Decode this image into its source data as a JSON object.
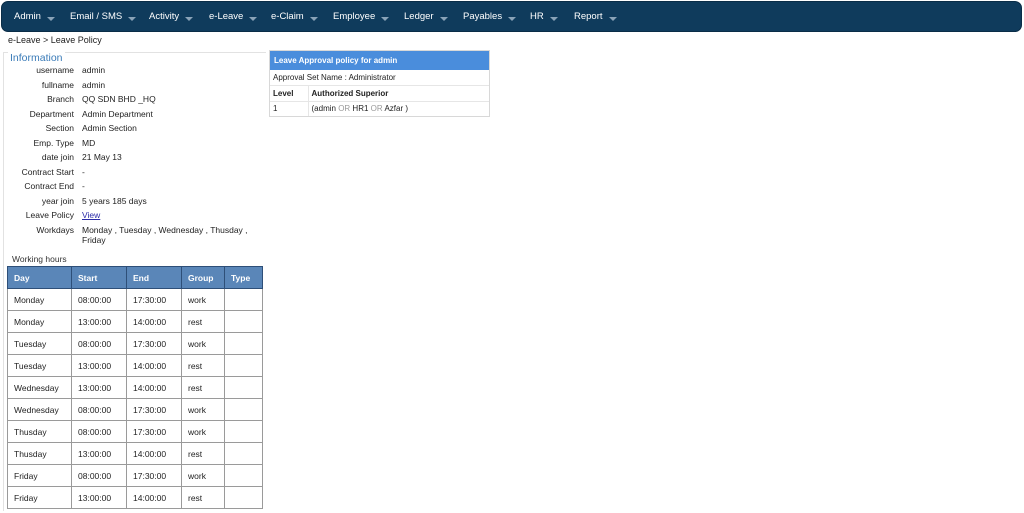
{
  "nav": {
    "items": [
      {
        "label": "Admin"
      },
      {
        "label": "Email / SMS"
      },
      {
        "label": "Activity"
      },
      {
        "label": "e-Leave"
      },
      {
        "label": "e-Claim"
      },
      {
        "label": "Employee"
      },
      {
        "label": "Ledger"
      },
      {
        "label": "Payables"
      },
      {
        "label": "HR"
      },
      {
        "label": "Report"
      }
    ]
  },
  "breadcrumb": "e-Leave > Leave Policy",
  "info": {
    "legend": "Information",
    "rows": [
      {
        "label": "username",
        "value": "admin"
      },
      {
        "label": "fullname",
        "value": "admin"
      },
      {
        "label": "Branch",
        "value": "QQ SDN BHD _HQ"
      },
      {
        "label": "Department",
        "value": "Admin Department"
      },
      {
        "label": "Section",
        "value": "Admin Section"
      },
      {
        "label": "Emp. Type",
        "value": "MD"
      },
      {
        "label": "date join",
        "value": "21 May 13"
      },
      {
        "label": "Contract Start",
        "value": "-"
      },
      {
        "label": "Contract End",
        "value": "-"
      },
      {
        "label": "year join",
        "value": "5 years 185 days"
      },
      {
        "label": "Leave Policy",
        "value": "View"
      },
      {
        "label": "Workdays",
        "value": "Monday , Tuesday , Wednesday , Thusday , Friday"
      }
    ]
  },
  "working_hours": {
    "title": "Working hours",
    "headers": [
      "Day",
      "Start",
      "End",
      "Group",
      "Type"
    ],
    "rows": [
      [
        "Monday",
        "08:00:00",
        "17:30:00",
        "work",
        ""
      ],
      [
        "Monday",
        "13:00:00",
        "14:00:00",
        "rest",
        ""
      ],
      [
        "Tuesday",
        "08:00:00",
        "17:30:00",
        "work",
        ""
      ],
      [
        "Tuesday",
        "13:00:00",
        "14:00:00",
        "rest",
        ""
      ],
      [
        "Wednesday",
        "13:00:00",
        "14:00:00",
        "rest",
        ""
      ],
      [
        "Wednesday",
        "08:00:00",
        "17:30:00",
        "work",
        ""
      ],
      [
        "Thusday",
        "08:00:00",
        "17:30:00",
        "work",
        ""
      ],
      [
        "Thusday",
        "13:00:00",
        "14:00:00",
        "rest",
        ""
      ],
      [
        "Friday",
        "08:00:00",
        "17:30:00",
        "work",
        ""
      ],
      [
        "Friday",
        "13:00:00",
        "14:00:00",
        "rest",
        ""
      ]
    ]
  },
  "policy": {
    "title": "Leave Approval policy for admin",
    "set_name": "Approval Set Name : Administrator",
    "col_level": "Level",
    "col_superior": "Authorized Superior",
    "row_level": "1",
    "sup_open": "(admin",
    "or1": "OR",
    "sup_mid": "HR1",
    "or2": "OR",
    "sup_close": "Azfar )"
  },
  "colors": {
    "nav_bg": "#0f3b5c",
    "table_header": "#5a86b8",
    "policy_header": "#4a8ddc",
    "legend": "#3a7bb8",
    "link": "#2a2aa8"
  }
}
